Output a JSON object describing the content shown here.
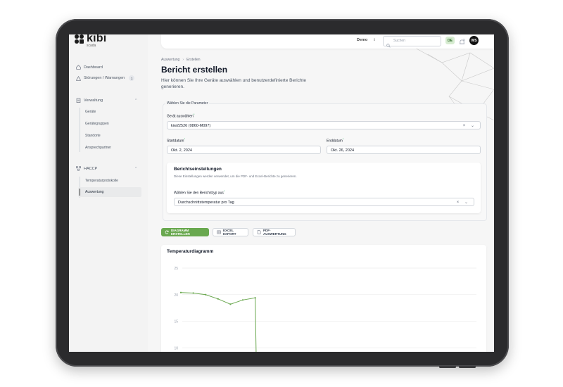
{
  "app": {
    "logo_word": "kibi",
    "logo_sub": "scada"
  },
  "sidebar": {
    "items": [
      {
        "label": "Dashboard",
        "icon": "home-icon"
      },
      {
        "label": "Störungen / Warnungen",
        "icon": "warning-icon",
        "badge": "1"
      }
    ],
    "groups": [
      {
        "label": "Verwaltung",
        "icon": "clipboard-icon",
        "children": [
          "Geräte",
          "Gerätegruppen",
          "Standorte",
          "Ansprechpartner"
        ]
      },
      {
        "label": "HACCP",
        "icon": "nodes-icon",
        "children": [
          "Temperaturprotokolle",
          "Auswertung"
        ],
        "active_child": "Auswertung"
      }
    ]
  },
  "topbar": {
    "tenant": "Demo",
    "search_placeholder": "Suchen",
    "language": "DE",
    "user_initials": "WS"
  },
  "breadcrumb": [
    "Auswertung",
    "Erstellen"
  ],
  "page": {
    "title": "Bericht erstellen",
    "description": "Hier können Sie Ihre Geräte auswählen und benutzerdefinierte Berichte generieren."
  },
  "params": {
    "legend": "Wählen Sie die Parameter",
    "device_label": "Gerät auswählen",
    "device_value": "kiw22526 (0860-M097)",
    "start_label": "Startdatum",
    "start_value": "Okt. 2, 2024",
    "end_label": "Enddatum",
    "end_value": "Okt. 26, 2024",
    "settings_title": "Berichtseinstellungen",
    "settings_desc": "Diese Einstellungen werden verwendet, um die PDF- und Excel-Berichte zu generieren.",
    "report_type_label": "Wählen Sie den Berichtstyp aus",
    "report_type_value": "Durchschnittstemperatur pro Tag"
  },
  "actions": {
    "diagram": "DIAGRAMM ERSTELLEN",
    "excel": "EXCEL EXPORT",
    "pdf": "PDF-AUSWERTUNG"
  },
  "colors": {
    "accent": "#69a84f",
    "line": "#6aa84f"
  },
  "chart_data": {
    "type": "line",
    "title": "Temperaturdiagramm",
    "xlabel": "",
    "ylabel": "",
    "y_ticks": [
      25,
      20,
      15,
      10
    ],
    "ylim": [
      10,
      25
    ],
    "grid": true,
    "series": [
      {
        "values": [
          20.4,
          20.3,
          20.0,
          19.2,
          18.2,
          19.0,
          19.4,
          4.0
        ]
      }
    ]
  }
}
